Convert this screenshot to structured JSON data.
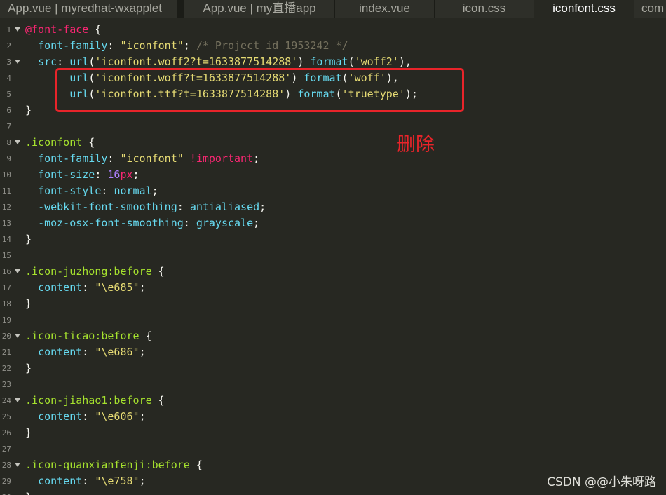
{
  "tabs": [
    {
      "label": "App.vue | myredhat-wxapplet",
      "active": false
    },
    {
      "label": "App.vue | my直播app",
      "active": false
    },
    {
      "label": "index.vue",
      "active": false
    },
    {
      "label": "icon.css",
      "active": false
    },
    {
      "label": "iconfont.css",
      "active": true
    },
    {
      "label": "com",
      "active": false
    }
  ],
  "lines": [
    {
      "n": "1",
      "fold": true,
      "tokens": [
        [
          "t-at",
          "@font-face"
        ],
        [
          "t-p",
          " {"
        ]
      ]
    },
    {
      "n": "2",
      "fold": false,
      "tokens": [
        [
          "t-p",
          "  "
        ],
        [
          "t-prop",
          "font-family"
        ],
        [
          "t-p",
          ": "
        ],
        [
          "t-str",
          "\"iconfont\""
        ],
        [
          "t-p",
          "; "
        ],
        [
          "t-com",
          "/* Project id 1953242 */"
        ]
      ]
    },
    {
      "n": "3",
      "fold": true,
      "tokens": [
        [
          "t-p",
          "  "
        ],
        [
          "t-prop",
          "src"
        ],
        [
          "t-p",
          ": "
        ],
        [
          "t-fn",
          "url"
        ],
        [
          "t-p",
          "("
        ],
        [
          "t-str",
          "'iconfont.woff2?t=1633877514288'"
        ],
        [
          "t-p",
          ") "
        ],
        [
          "t-fn",
          "format"
        ],
        [
          "t-p",
          "("
        ],
        [
          "t-str",
          "'woff2'"
        ],
        [
          "t-p",
          "),"
        ]
      ]
    },
    {
      "n": "4",
      "fold": false,
      "tokens": [
        [
          "t-p",
          "       "
        ],
        [
          "t-fn",
          "url"
        ],
        [
          "t-p",
          "("
        ],
        [
          "t-str",
          "'iconfont.woff?t=1633877514288'"
        ],
        [
          "t-p",
          ") "
        ],
        [
          "t-fn",
          "format"
        ],
        [
          "t-p",
          "("
        ],
        [
          "t-str",
          "'woff'"
        ],
        [
          "t-p",
          "),"
        ]
      ]
    },
    {
      "n": "5",
      "fold": false,
      "tokens": [
        [
          "t-p",
          "       "
        ],
        [
          "t-fn",
          "url"
        ],
        [
          "t-p",
          "("
        ],
        [
          "t-str",
          "'iconfont.ttf?t=1633877514288'"
        ],
        [
          "t-p",
          ") "
        ],
        [
          "t-fn",
          "format"
        ],
        [
          "t-p",
          "("
        ],
        [
          "t-str",
          "'truetype'"
        ],
        [
          "t-p",
          ");"
        ]
      ]
    },
    {
      "n": "6",
      "fold": false,
      "tokens": [
        [
          "t-p",
          "}"
        ]
      ]
    },
    {
      "n": "7",
      "fold": false,
      "tokens": []
    },
    {
      "n": "8",
      "fold": true,
      "tokens": [
        [
          "t-sel",
          ".iconfont"
        ],
        [
          "t-p",
          " {"
        ]
      ]
    },
    {
      "n": "9",
      "fold": false,
      "tokens": [
        [
          "t-p",
          "  "
        ],
        [
          "t-prop",
          "font-family"
        ],
        [
          "t-p",
          ": "
        ],
        [
          "t-str",
          "\"iconfont\""
        ],
        [
          "t-p",
          " "
        ],
        [
          "t-kw",
          "!important"
        ],
        [
          "t-p",
          ";"
        ]
      ]
    },
    {
      "n": "10",
      "fold": false,
      "tokens": [
        [
          "t-p",
          "  "
        ],
        [
          "t-prop",
          "font-size"
        ],
        [
          "t-p",
          ": "
        ],
        [
          "t-num",
          "16"
        ],
        [
          "t-kw",
          "px"
        ],
        [
          "t-p",
          ";"
        ]
      ]
    },
    {
      "n": "11",
      "fold": false,
      "tokens": [
        [
          "t-p",
          "  "
        ],
        [
          "t-prop",
          "font-style"
        ],
        [
          "t-p",
          ": "
        ],
        [
          "t-val",
          "normal"
        ],
        [
          "t-p",
          ";"
        ]
      ]
    },
    {
      "n": "12",
      "fold": false,
      "tokens": [
        [
          "t-p",
          "  "
        ],
        [
          "t-prop",
          "-webkit-font-smoothing"
        ],
        [
          "t-p",
          ": "
        ],
        [
          "t-val",
          "antialiased"
        ],
        [
          "t-p",
          ";"
        ]
      ]
    },
    {
      "n": "13",
      "fold": false,
      "tokens": [
        [
          "t-p",
          "  "
        ],
        [
          "t-prop",
          "-moz-osx-font-smoothing"
        ],
        [
          "t-p",
          ": "
        ],
        [
          "t-val",
          "grayscale"
        ],
        [
          "t-p",
          ";"
        ]
      ]
    },
    {
      "n": "14",
      "fold": false,
      "tokens": [
        [
          "t-p",
          "}"
        ]
      ]
    },
    {
      "n": "15",
      "fold": false,
      "tokens": []
    },
    {
      "n": "16",
      "fold": true,
      "tokens": [
        [
          "t-sel",
          ".icon-juzhong:before"
        ],
        [
          "t-p",
          " {"
        ]
      ]
    },
    {
      "n": "17",
      "fold": false,
      "tokens": [
        [
          "t-p",
          "  "
        ],
        [
          "t-prop",
          "content"
        ],
        [
          "t-p",
          ": "
        ],
        [
          "t-str",
          "\"\\e685\""
        ],
        [
          "t-p",
          ";"
        ]
      ]
    },
    {
      "n": "18",
      "fold": false,
      "tokens": [
        [
          "t-p",
          "}"
        ]
      ]
    },
    {
      "n": "19",
      "fold": false,
      "tokens": []
    },
    {
      "n": "20",
      "fold": true,
      "tokens": [
        [
          "t-sel",
          ".icon-ticao:before"
        ],
        [
          "t-p",
          " {"
        ]
      ]
    },
    {
      "n": "21",
      "fold": false,
      "tokens": [
        [
          "t-p",
          "  "
        ],
        [
          "t-prop",
          "content"
        ],
        [
          "t-p",
          ": "
        ],
        [
          "t-str",
          "\"\\e686\""
        ],
        [
          "t-p",
          ";"
        ]
      ]
    },
    {
      "n": "22",
      "fold": false,
      "tokens": [
        [
          "t-p",
          "}"
        ]
      ]
    },
    {
      "n": "23",
      "fold": false,
      "tokens": []
    },
    {
      "n": "24",
      "fold": true,
      "tokens": [
        [
          "t-sel",
          ".icon-jiahao1:before"
        ],
        [
          "t-p",
          " {"
        ]
      ]
    },
    {
      "n": "25",
      "fold": false,
      "tokens": [
        [
          "t-p",
          "  "
        ],
        [
          "t-prop",
          "content"
        ],
        [
          "t-p",
          ": "
        ],
        [
          "t-str",
          "\"\\e606\""
        ],
        [
          "t-p",
          ";"
        ]
      ]
    },
    {
      "n": "26",
      "fold": false,
      "tokens": [
        [
          "t-p",
          "}"
        ]
      ]
    },
    {
      "n": "27",
      "fold": false,
      "tokens": []
    },
    {
      "n": "28",
      "fold": true,
      "tokens": [
        [
          "t-sel",
          ".icon-quanxianfenji:before"
        ],
        [
          "t-p",
          " {"
        ]
      ]
    },
    {
      "n": "29",
      "fold": false,
      "tokens": [
        [
          "t-p",
          "  "
        ],
        [
          "t-prop",
          "content"
        ],
        [
          "t-p",
          ": "
        ],
        [
          "t-str",
          "\"\\e758\""
        ],
        [
          "t-p",
          ";"
        ]
      ]
    },
    {
      "n": "30",
      "fold": false,
      "tokens": [
        [
          "t-p",
          "}"
        ]
      ]
    }
  ],
  "annotation": {
    "label": "删除",
    "color": "#e8242a"
  },
  "watermark": "CSDN @@小朱呀路",
  "colors": {
    "background": "#272822",
    "selector": "#a6e22e",
    "keyword": "#f92672",
    "string": "#e6db74",
    "property": "#66d9ef",
    "comment": "#75715e",
    "number": "#ae81ff"
  }
}
